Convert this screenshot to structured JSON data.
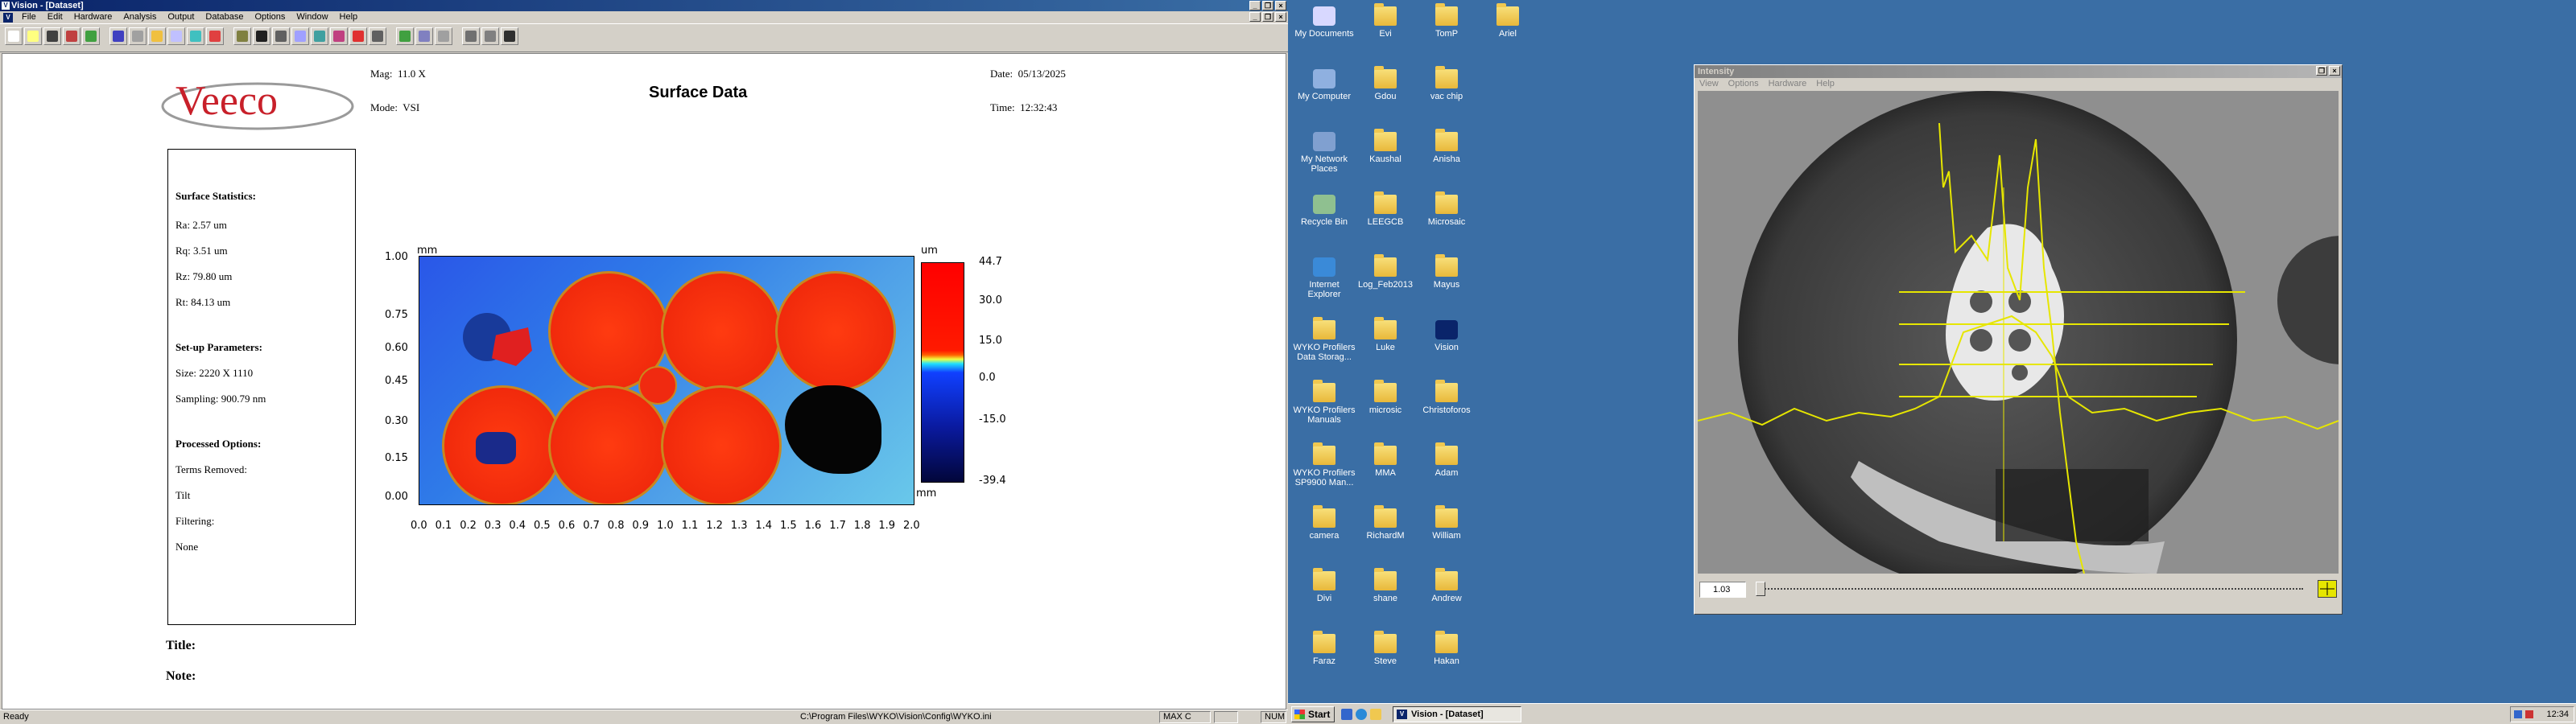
{
  "app": {
    "title": "Vision - [Dataset]",
    "menu": [
      "File",
      "Edit",
      "Hardware",
      "Analysis",
      "Output",
      "Database",
      "Options",
      "Window",
      "Help"
    ]
  },
  "report": {
    "logo_text": "Veeco",
    "mag_label": "Mag:",
    "mag_value": "11.0 X",
    "mode_label": "Mode:",
    "mode_value": "VSI",
    "heading": "Surface Data",
    "date_label": "Date:",
    "date_value": "05/13/2025",
    "time_label": "Time:",
    "time_value": "12:32:43",
    "stats": {
      "section1": "Surface Statistics:",
      "ra": "Ra:  2.57 um",
      "rq": "Rq:  3.51 um",
      "rz": "Rz:  79.80 um",
      "rt": "Rt:  84.13 um",
      "section2": "Set-up Parameters:",
      "size": "Size: 2220 X 1110",
      "sampling": "Sampling:  900.79 nm",
      "section3": "Processed Options:",
      "terms_removed": "Terms Removed:",
      "tilt": "Tilt",
      "filtering": "Filtering:",
      "none": "None"
    },
    "title_label": "Title:",
    "note_label": "Note:"
  },
  "plot": {
    "y_unit": "mm",
    "x_unit": "mm",
    "y_ticks": [
      "1.00",
      "0.75",
      "0.60",
      "0.45",
      "0.30",
      "0.15",
      "0.00"
    ],
    "x_ticks": [
      "0.0",
      "0.1",
      "0.2",
      "0.3",
      "0.4",
      "0.5",
      "0.6",
      "0.7",
      "0.8",
      "0.9",
      "1.0",
      "1.1",
      "1.2",
      "1.3",
      "1.4",
      "1.5",
      "1.6",
      "1.7",
      "1.8",
      "1.9",
      "2.0"
    ],
    "colorbar_unit": "um",
    "colorbar_ticks": [
      "44.7",
      "30.0",
      "15.0",
      "0.0",
      "-15.0",
      "-39.4"
    ]
  },
  "statusbar": {
    "ready": "Ready",
    "path": "C:\\Program Files\\WYKO\\Vision\\Config\\WYKO.ini",
    "max": "MAX C",
    "num": "NUM"
  },
  "desktop": {
    "icons": [
      "My Documents",
      "Evi",
      "TomP",
      "Ariel",
      "My Computer",
      "Gdou",
      "vac chip",
      "My Network Places",
      "Kaushal",
      "Anisha",
      "Recycle Bin",
      "LEEGCB",
      "Microsaic",
      "Internet Explorer",
      "Log_Feb2013",
      "Mayus",
      "WYKO Profilers Data Storag...",
      "Luke",
      "Vision",
      "WYKO Profilers Manuals",
      "microsic",
      "Christoforos",
      "WYKO Profilers SP9900 Man...",
      "MMA",
      "Adam",
      "camera",
      "RichardM",
      "William",
      "Divi",
      "shane",
      "Andrew",
      "Faraz",
      "Steve",
      "Hakan"
    ]
  },
  "intensity": {
    "title": "Intensity",
    "menu": [
      "View",
      "Options",
      "Hardware",
      "Help"
    ],
    "value": "1.03"
  },
  "taskbar": {
    "start": "Start",
    "task": "Vision - [Dataset]",
    "clock": "12:34"
  }
}
